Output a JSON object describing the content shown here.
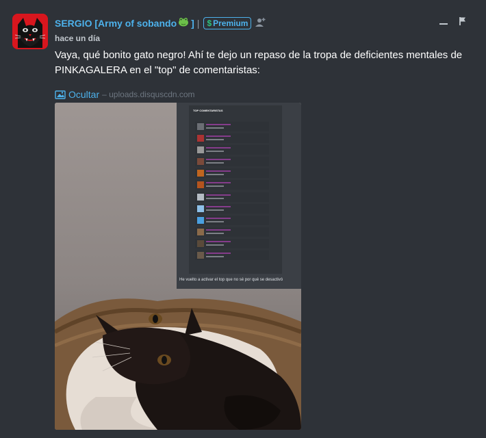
{
  "comment": {
    "username": "SERGIO [Army of sobando",
    "username_close": "]",
    "separator": "|",
    "premium_label": "Premium",
    "premium_symbol": "$",
    "timestamp": "hace un día",
    "text": "Vaya, qué bonito gato negro! Ahí te dejo un repaso de la tropa de deficientes mentales de PINKAGALERA en el \"top\" de comentaristas:",
    "media": {
      "toggle_label": "Ocultar",
      "source": "– uploads.disquscdn.com",
      "inner_title": "TOP COMENTARISTAS",
      "caption": "He vuelto a activar el top que no sé por qué se desactivó"
    }
  },
  "icons": {
    "avatar": "black-cat-avatar",
    "frog": "frog-emoji",
    "follow": "add-user-icon",
    "collapse": "minus-icon",
    "flag": "flag-icon",
    "media": "image-icon"
  },
  "colors": {
    "background": "#2e3238",
    "link": "#4db2ec",
    "premium_dollar": "#2ec27e",
    "muted": "#6d7680",
    "avatar_bg": "#d8161e"
  }
}
